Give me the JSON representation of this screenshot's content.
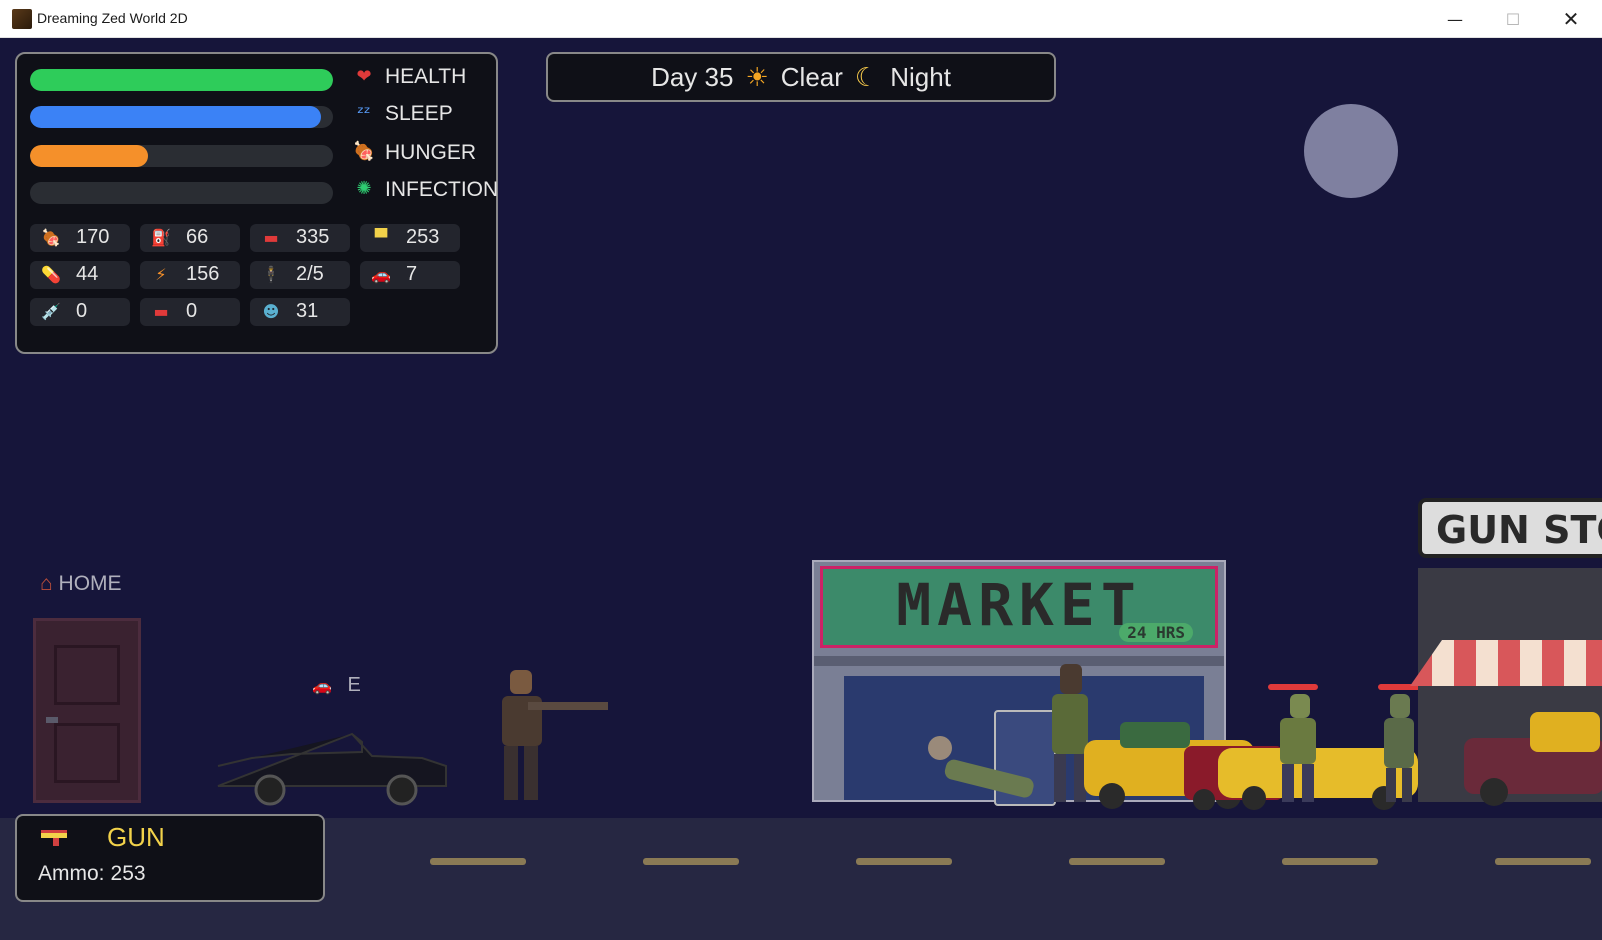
{
  "window": {
    "title": "Dreaming Zed World 2D",
    "minimize": "—",
    "maximize": "☐",
    "close": "✕"
  },
  "stats": [
    {
      "label": "HEALTH",
      "icon": "heart-icon",
      "glyph": "❤",
      "color": "#2ecc5a",
      "level": 1.0
    },
    {
      "label": "SLEEP",
      "icon": "sleep-icon",
      "glyph": "ᶻᶻ",
      "color": "#3b82f6",
      "level": 0.96
    },
    {
      "label": "HUNGER",
      "icon": "meat-icon",
      "glyph": "🍖",
      "color": "#f5902a",
      "level": 0.39
    },
    {
      "label": "INFECTION",
      "icon": "virus-icon",
      "glyph": "✺",
      "color": "#2ecc71",
      "level": 0.0
    }
  ],
  "resources": [
    {
      "icon": "meat-icon",
      "glyph": "🍖",
      "value": "170"
    },
    {
      "icon": "fuel-can-icon",
      "glyph": "⛽",
      "value": "66"
    },
    {
      "icon": "toolbox-icon",
      "glyph": "▬",
      "value": "335"
    },
    {
      "icon": "gun-icon",
      "glyph": "▀",
      "value": "253"
    },
    {
      "icon": "pill-icon",
      "glyph": "💊",
      "value": "44"
    },
    {
      "icon": "lightning-icon",
      "glyph": "⚡",
      "value": "156"
    },
    {
      "icon": "survivor-icon",
      "glyph": "🕴",
      "value": "2/5"
    },
    {
      "icon": "car-icon",
      "glyph": "🚗",
      "value": "7"
    },
    {
      "icon": "syringe-icon",
      "glyph": "💉",
      "value": "0"
    },
    {
      "icon": "medkit-icon",
      "glyph": "▬",
      "value": "0"
    },
    {
      "icon": "zombie-icon",
      "glyph": "☻",
      "value": "31"
    }
  ],
  "day_panel": {
    "day": "Day 35",
    "weather": "Clear",
    "phase": "Night",
    "sun_glyph": "☀",
    "moon_glyph": "☾"
  },
  "world": {
    "home_label": "HOME",
    "car_key_label": "E",
    "market_sign": "MARKET",
    "market_sub": "24 HRS",
    "gunstore_sign": "GUN STO"
  },
  "weapon": {
    "name": "GUN",
    "ammo_label": "Ammo:",
    "ammo_value": "253",
    "icon": "gun-icon"
  }
}
